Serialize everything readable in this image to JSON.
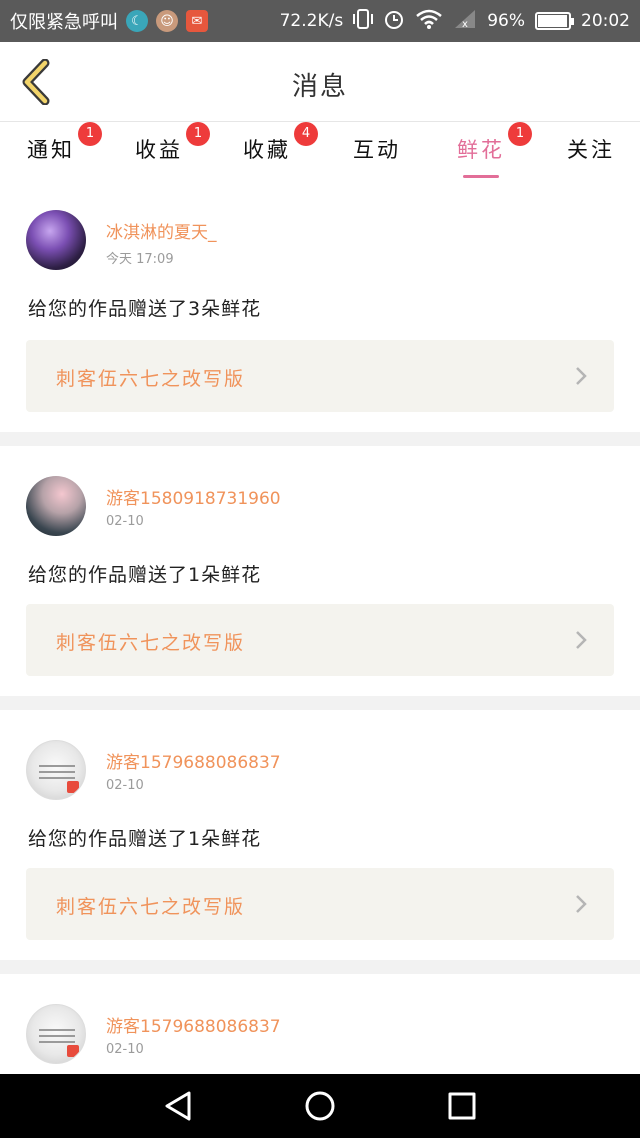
{
  "status_bar": {
    "carrier_text": "仅限紧急呼叫",
    "network_speed": "72.2K/s",
    "battery": "96%",
    "battery_level": 0.96,
    "time": "20:02",
    "icons": [
      "moon-app-icon",
      "avatar-app-icon",
      "mail-app-icon",
      "vibrate-icon",
      "alarm-icon",
      "wifi-icon",
      "signal-icon",
      "battery-icon"
    ]
  },
  "header": {
    "title": "消息",
    "back_icon": "back-chevron-icon"
  },
  "tabs": [
    {
      "label": "通知",
      "badge": "1",
      "active": false
    },
    {
      "label": "收益",
      "badge": "1",
      "active": false
    },
    {
      "label": "收藏",
      "badge": "4",
      "active": false
    },
    {
      "label": "互动",
      "badge": "",
      "active": false
    },
    {
      "label": "鲜花",
      "badge": "1",
      "active": true
    },
    {
      "label": "关注",
      "badge": "",
      "active": false
    }
  ],
  "messages": [
    {
      "username": "冰淇淋的夏天_",
      "time": "今天 17:09",
      "text": "给您的作品赠送了3朵鲜花",
      "work_title": "刺客伍六七之改写版"
    },
    {
      "username": "游客1580918731960",
      "time": "02-10",
      "text": "给您的作品赠送了1朵鲜花",
      "work_title": "刺客伍六七之改写版"
    },
    {
      "username": "游客1579688086837",
      "time": "02-10",
      "text": "给您的作品赠送了1朵鲜花",
      "work_title": "刺客伍六七之改写版"
    },
    {
      "username": "游客1579688086837",
      "time": "02-10",
      "text": "",
      "work_title": ""
    }
  ],
  "nav_bar": {
    "icons": [
      "back-triangle-icon",
      "home-circle-icon",
      "recents-square-icon"
    ]
  },
  "colors": {
    "accent": "#e26e98",
    "username": "#f0935b",
    "badge": "#ee3b3b",
    "card_box": "#f4f3ee"
  }
}
